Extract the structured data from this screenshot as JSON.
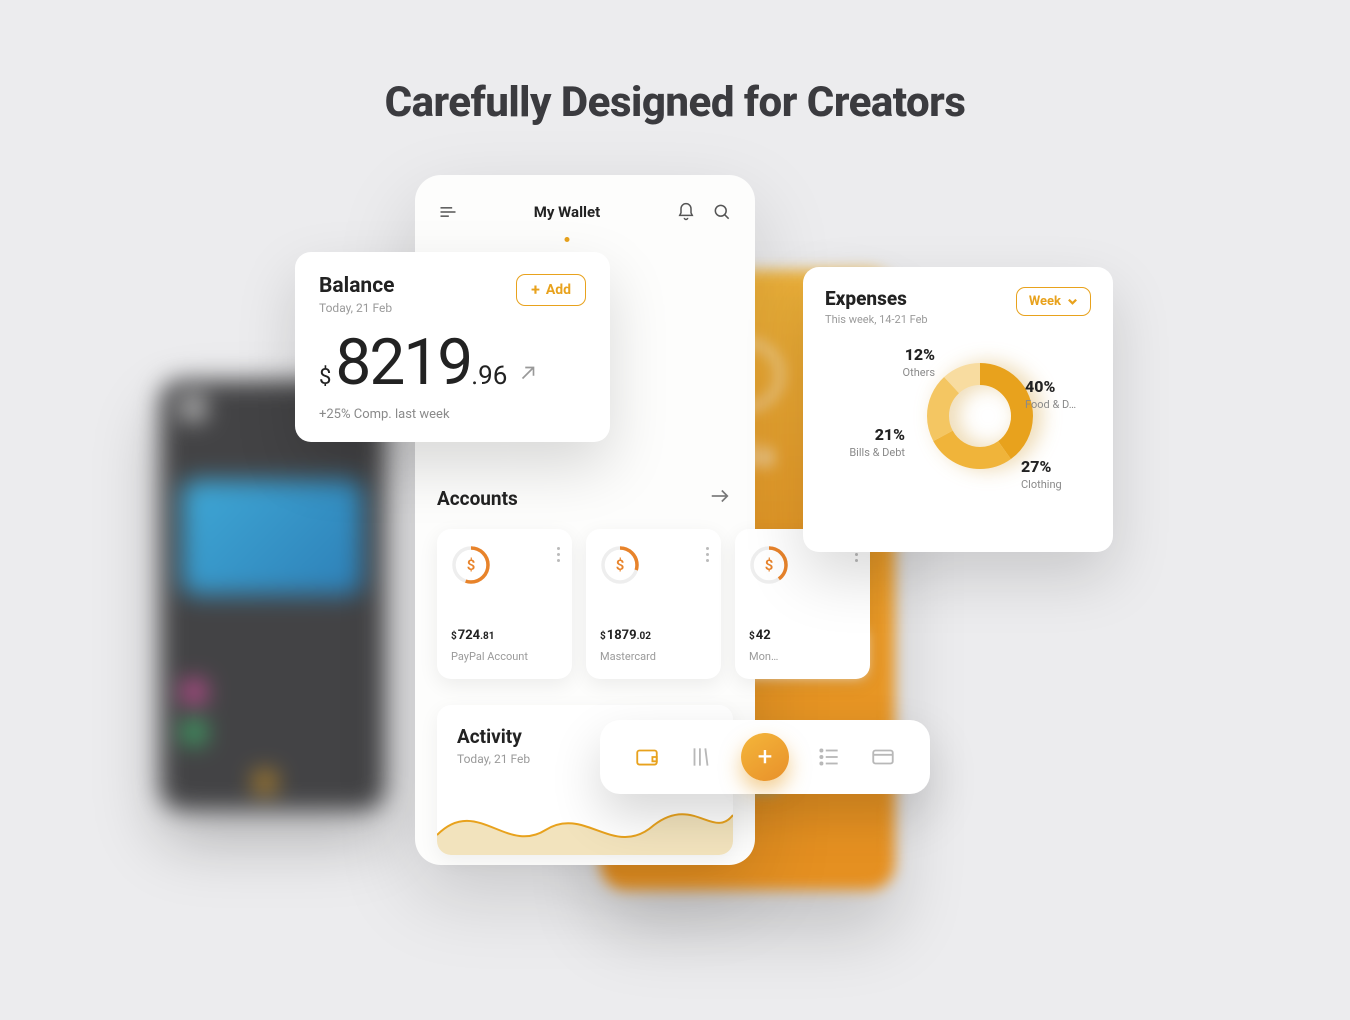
{
  "headline": "Carefully Designed for Creators",
  "phone": {
    "title": "My Wallet"
  },
  "balance": {
    "title": "Balance",
    "date": "Today, 21 Feb",
    "add_label": "Add",
    "currency": "$",
    "whole": "8219",
    "decimals": ".96",
    "comparison": "+25% Comp. last week"
  },
  "accounts": {
    "title": "Accounts",
    "items": [
      {
        "currency": "$",
        "whole": "724",
        "decimals": ".81",
        "name": "PayPal Account",
        "progress": 55
      },
      {
        "currency": "$",
        "whole": "1879",
        "decimals": ".02",
        "name": "Mastercard",
        "progress": 30
      },
      {
        "currency": "$",
        "whole": "42",
        "decimals": "",
        "name": "Mon…",
        "progress": 40
      }
    ]
  },
  "activity": {
    "title": "Activity",
    "date": "Today, 21 Feb"
  },
  "expenses": {
    "title": "Expenses",
    "date": "This week, 14-21 Feb",
    "range_label": "Week",
    "segments": {
      "others": {
        "pct": "12%",
        "label": "Others"
      },
      "bills": {
        "pct": "21%",
        "label": "Bills & Debt"
      },
      "food": {
        "pct": "40%",
        "label": "Food & D…"
      },
      "clothing": {
        "pct": "27%",
        "label": "Clothing"
      }
    }
  },
  "colors": {
    "accent": "#e8a21d"
  },
  "chart_data": {
    "type": "pie",
    "title": "Expenses",
    "categories": [
      "Food & Drinks",
      "Clothing",
      "Bills & Debt",
      "Others"
    ],
    "values": [
      40,
      27,
      21,
      12
    ],
    "colors": [
      "#e8a21d",
      "#f0b43a",
      "#f4c662",
      "#f8dca0"
    ]
  }
}
